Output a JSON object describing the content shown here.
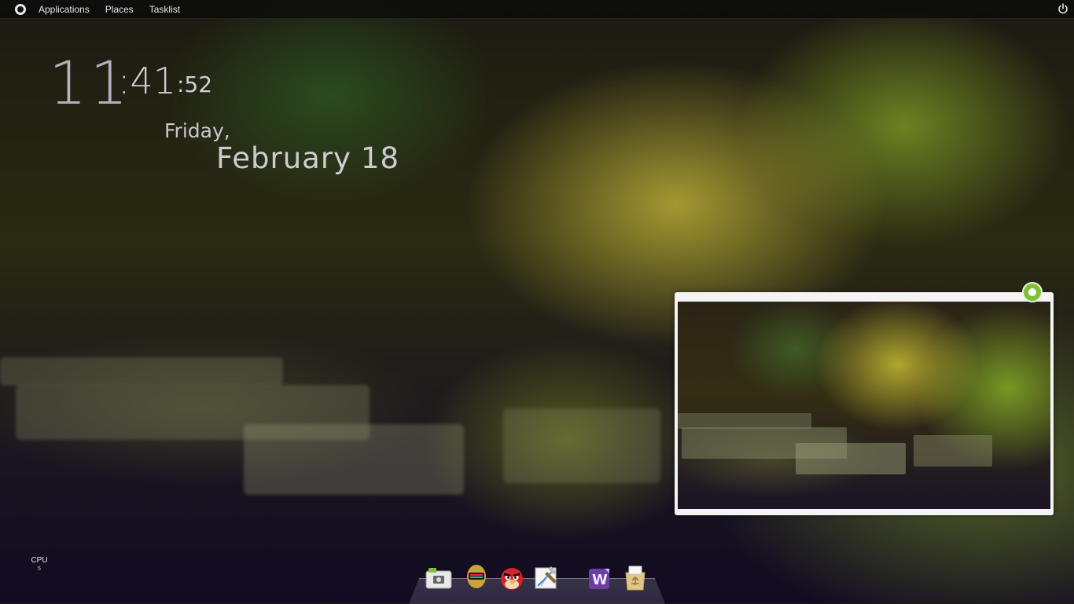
{
  "panel": {
    "menus": [
      {
        "label": "Applications"
      },
      {
        "label": "Places"
      },
      {
        "label": "Tasklist"
      }
    ],
    "logo_icon": "gnome-foot-circle-icon",
    "power_icon": "power-icon"
  },
  "clock": {
    "hours": "11",
    "minutes": ":41",
    "seconds": ":52",
    "day": "Friday,",
    "month": "February",
    "date": "18"
  },
  "cpu": {
    "label": "CPU",
    "value": "5"
  },
  "preview": {
    "pin_icon": "pin-icon"
  },
  "dock": {
    "items": [
      {
        "icon": "screenshot-camera-icon"
      },
      {
        "icon": "daft-punk-helmet-icon"
      },
      {
        "icon": "angry-birds-icon"
      },
      {
        "icon": "xcode-hammer-icon"
      },
      {
        "icon": "wine-w-icon"
      },
      {
        "icon": "trash-recycle-icon"
      }
    ]
  },
  "colors": {
    "panel_text": "#e6e6e6",
    "clock_text": "#e1dce6",
    "accent_green": "#7fbf3a"
  }
}
